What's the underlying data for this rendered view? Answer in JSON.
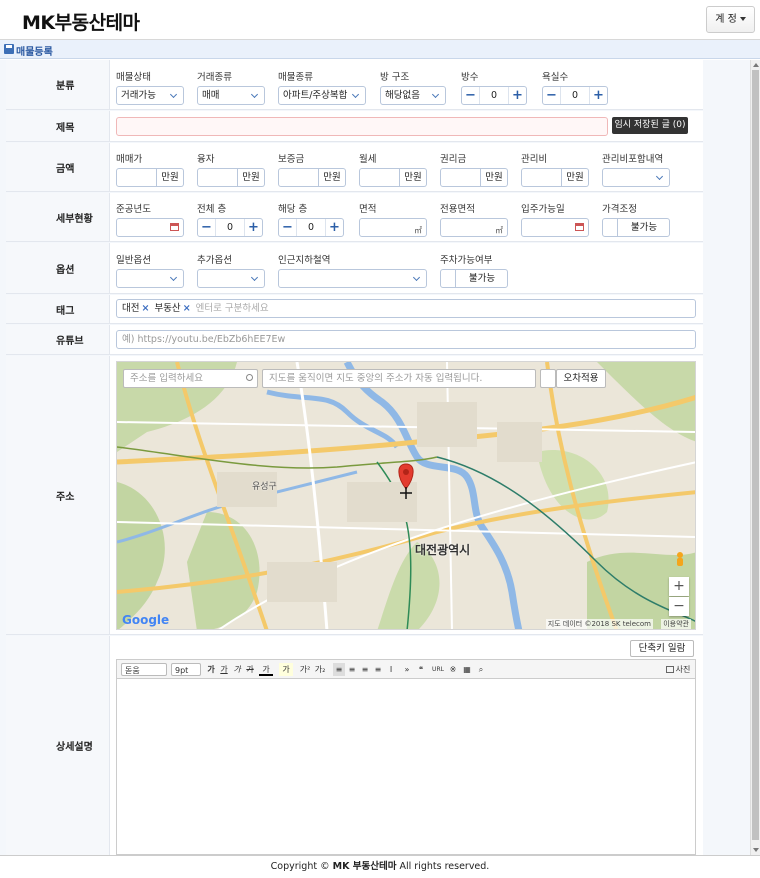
{
  "brand": "MK부동산테마",
  "account_button": "계 정",
  "page_title": "매물등록",
  "category": {
    "label": "분류",
    "status": {
      "label": "매물상태",
      "value": "거래가능"
    },
    "deal": {
      "label": "거래종류",
      "value": "매매"
    },
    "type": {
      "label": "매물종류",
      "value": "아파트/주상복합"
    },
    "room": {
      "label": "방 구조",
      "value": "해당없음"
    },
    "rooms": {
      "label": "방수",
      "value": "0"
    },
    "baths": {
      "label": "욕실수",
      "value": "0"
    }
  },
  "title_row": {
    "label": "제목",
    "value": "",
    "saved_button": "임시 저장된 글 (0)"
  },
  "price": {
    "label": "금액",
    "unit": "만원",
    "fields": [
      "매매가",
      "융자",
      "보증금",
      "월세",
      "권리금",
      "관리비"
    ],
    "mgmt_incl": "관리비포함내역"
  },
  "detail": {
    "label": "세부현황",
    "built_year": "준공년도",
    "total_floor": {
      "label": "전체 층",
      "value": "0"
    },
    "floor": {
      "label": "해당 층",
      "value": "0"
    },
    "area": "면적",
    "exclusive_area": "전용면적",
    "move_in": "입주가능일",
    "price_adjust": {
      "label": "가격조정",
      "value": "불가능"
    },
    "area_unit": "㎡"
  },
  "options": {
    "label": "옵션",
    "general": "일반옵션",
    "extra": "추가옵션",
    "subway": "인근지하철역",
    "parking": {
      "label": "주차가능여부",
      "value": "불가능"
    }
  },
  "tags": {
    "label": "태그",
    "items": [
      "대전",
      "부동산"
    ],
    "placeholder": "엔터로 구분하세요"
  },
  "youtube": {
    "label": "유튜브",
    "placeholder": "예) https://youtu.be/EbZb6hEE7Ew"
  },
  "address": {
    "label": "주소",
    "search_placeholder": "주소를 입력하세요",
    "map_hint": "지도를 움직이면 지도 중앙의 주소가 자동 입력됩니다.",
    "error_button": "오차적용",
    "city_label": "대전광역시",
    "district_label": "유성구",
    "copyright": "지도 데이터 ©2018 SK telecom",
    "terms": "이용약관",
    "google": "Google"
  },
  "description": {
    "label": "상세설명",
    "shortcut_button": "단축키 일람",
    "font": "돋움",
    "size": "9pt",
    "photo": "사진"
  },
  "footer": {
    "prefix": "Copyright ©",
    "brand": "MK 부동산테마",
    "suffix": "All rights reserved."
  },
  "colors": {
    "accent": "#2b5aa2",
    "border": "#b9c7dc",
    "pin": "#e33b2e"
  }
}
